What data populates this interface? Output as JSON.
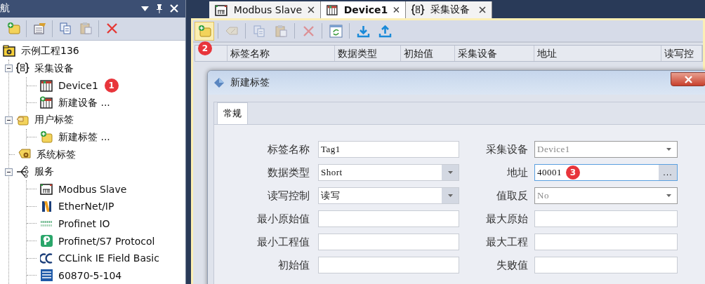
{
  "nav": {
    "title": "航",
    "toolbar": [
      {
        "kind": "add-folder",
        "disabled": false
      },
      {
        "kind": "properties",
        "disabled": false
      },
      {
        "kind": "copy",
        "disabled": false
      },
      {
        "kind": "paste",
        "disabled": true
      },
      {
        "kind": "delete",
        "disabled": false
      }
    ],
    "tree": [
      {
        "label": "示例工程136",
        "kind": "project",
        "children": [
          {
            "label": "采集设备",
            "kind": "collector",
            "expanded": true,
            "children": [
              {
                "label": "Device1",
                "kind": "device",
                "badge": "1"
              },
              {
                "label": "新建设备 ...",
                "kind": "new-device"
              }
            ]
          },
          {
            "label": "用户标签",
            "kind": "user-tags",
            "expanded": true,
            "children": [
              {
                "label": "新建标签 ...",
                "kind": "new-tag"
              }
            ]
          },
          {
            "label": "系统标签",
            "kind": "system-tags"
          },
          {
            "label": "服务",
            "kind": "services",
            "expanded": true,
            "children": [
              {
                "label": "Modbus Slave",
                "kind": "modbus"
              },
              {
                "label": "EtherNet/IP",
                "kind": "ethernetip"
              },
              {
                "label": "Profinet IO",
                "kind": "profinet"
              },
              {
                "label": "Profinet/S7 Protocol",
                "kind": "profinet-s7"
              },
              {
                "label": "CCLink IE Field Basic",
                "kind": "cclink"
              },
              {
                "label": "60870-5-104",
                "kind": "iec"
              }
            ]
          }
        ]
      }
    ]
  },
  "tabs": [
    {
      "label": "Modbus Slave",
      "kind": "modbus",
      "selected": false
    },
    {
      "label": "Device1",
      "kind": "device",
      "selected": true
    },
    {
      "label": "采集设备",
      "kind": "collector",
      "selected": false
    }
  ],
  "toolbar": [
    {
      "kind": "new-tag",
      "highlighted": true,
      "disabled": false,
      "badge": "2"
    },
    {
      "kind": "tag",
      "highlighted": false,
      "disabled": true
    },
    {
      "kind": "copy",
      "highlighted": false,
      "disabled": true
    },
    {
      "kind": "paste",
      "highlighted": false,
      "disabled": true
    },
    {
      "kind": "delete",
      "highlighted": false,
      "disabled": true
    },
    {
      "kind": "refresh",
      "highlighted": false,
      "disabled": false
    },
    {
      "kind": "download",
      "highlighted": false,
      "disabled": false
    },
    {
      "kind": "upload",
      "highlighted": false,
      "disabled": false
    }
  ],
  "table": {
    "columns": [
      "标签名称",
      "数据类型",
      "初始值",
      "采集设备",
      "地址",
      "读写控"
    ]
  },
  "dialog": {
    "title": "新建标签",
    "tabs": [
      {
        "label": "常规",
        "selected": true
      }
    ],
    "fields": [
      {
        "label": "标签名称",
        "value": "Tag1",
        "kind": "text"
      },
      {
        "label": "采集设备",
        "value": "Device1",
        "kind": "combo",
        "disabled": true
      },
      {
        "label": "数据类型",
        "value": "Short",
        "kind": "combo"
      },
      {
        "label": "地址",
        "value": "40001",
        "kind": "browse",
        "focused": true,
        "badge": "3",
        "button": "..."
      },
      {
        "label": "读写控制",
        "value": "读写",
        "kind": "combo"
      },
      {
        "label": "值取反",
        "value": "No",
        "kind": "combo",
        "disabled": true
      },
      {
        "label": "最小原始值",
        "kind": "text"
      },
      {
        "label": "最大原始",
        "kind": "text"
      },
      {
        "label": "最小工程值",
        "kind": "text"
      },
      {
        "label": "最大工程",
        "kind": "text"
      },
      {
        "label": "初始值",
        "kind": "text"
      },
      {
        "label": "失败值",
        "kind": "text"
      }
    ]
  }
}
